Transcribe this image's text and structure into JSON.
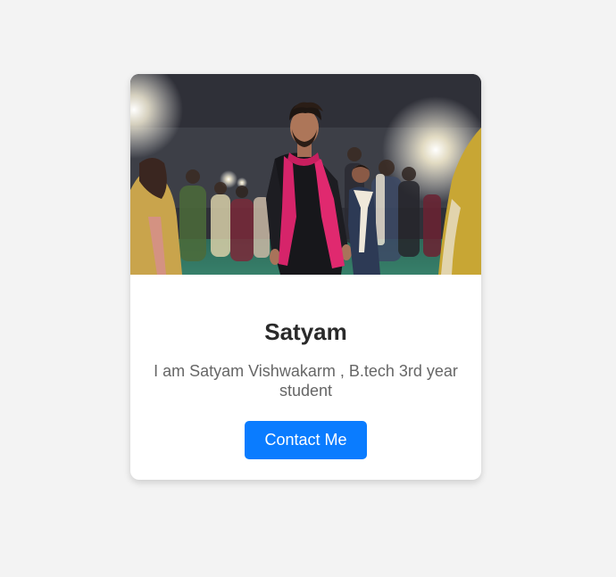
{
  "profile_card": {
    "name": "Satyam",
    "bio": "I am Satyam Vishwakarm , B.tech 3rd year student",
    "contact_button_label": "Contact Me"
  },
  "colors": {
    "background": "#f3f3f3",
    "card": "#ffffff",
    "button": "#0a7cff",
    "name_text": "#2a2a2a",
    "bio_text": "#666666"
  }
}
